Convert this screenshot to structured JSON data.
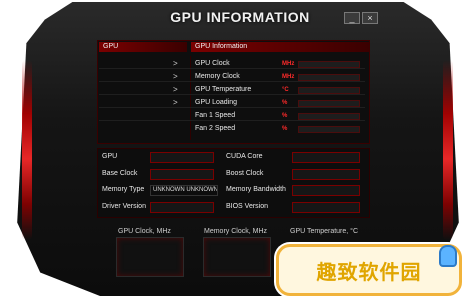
{
  "window": {
    "title": "GPU INFORMATION",
    "minimize_label": "_",
    "close_label": "×"
  },
  "left_panel": {
    "header": "GPU",
    "rows": [
      {
        "arrow": ">"
      },
      {
        "arrow": ">"
      },
      {
        "arrow": ">"
      },
      {
        "arrow": ">"
      }
    ]
  },
  "right_panel": {
    "header": "GPU Information",
    "metrics": [
      {
        "label": "GPU Clock",
        "unit": "MHz"
      },
      {
        "label": "Memory Clock",
        "unit": "MHz"
      },
      {
        "label": "GPU Temperature",
        "unit": "°C"
      },
      {
        "label": "GPU Loading",
        "unit": "%"
      },
      {
        "label": "Fan 1 Speed",
        "unit": "%"
      },
      {
        "label": "Fan 2 Speed",
        "unit": "%"
      }
    ]
  },
  "details": {
    "gpu": {
      "label": "GPU",
      "value": ""
    },
    "cuda_core": {
      "label": "CUDA Core",
      "value": ""
    },
    "base_clock": {
      "label": "Base Clock",
      "value": ""
    },
    "boost_clock": {
      "label": "Boost Clock",
      "value": ""
    },
    "memory_type": {
      "label": "Memory Type",
      "value": "UNKNOWN  UNKNOWN"
    },
    "memory_bandwidth": {
      "label": "Memory Bandwidth",
      "value": ""
    },
    "driver_version": {
      "label": "Driver Version",
      "value": ""
    },
    "bios_version": {
      "label": "BIOS Version",
      "value": ""
    }
  },
  "gauges": {
    "gpu_clock": "GPU  Clock, MHz",
    "memory_clock": "Memory  Clock, MHz",
    "gpu_temperature": "GPU  Temperature, °C"
  },
  "watermark": {
    "text": "趣致软件园"
  },
  "colors": {
    "accent": "#ff2a2a",
    "frame": "#151515",
    "watermark_border": "#f1b33b"
  }
}
